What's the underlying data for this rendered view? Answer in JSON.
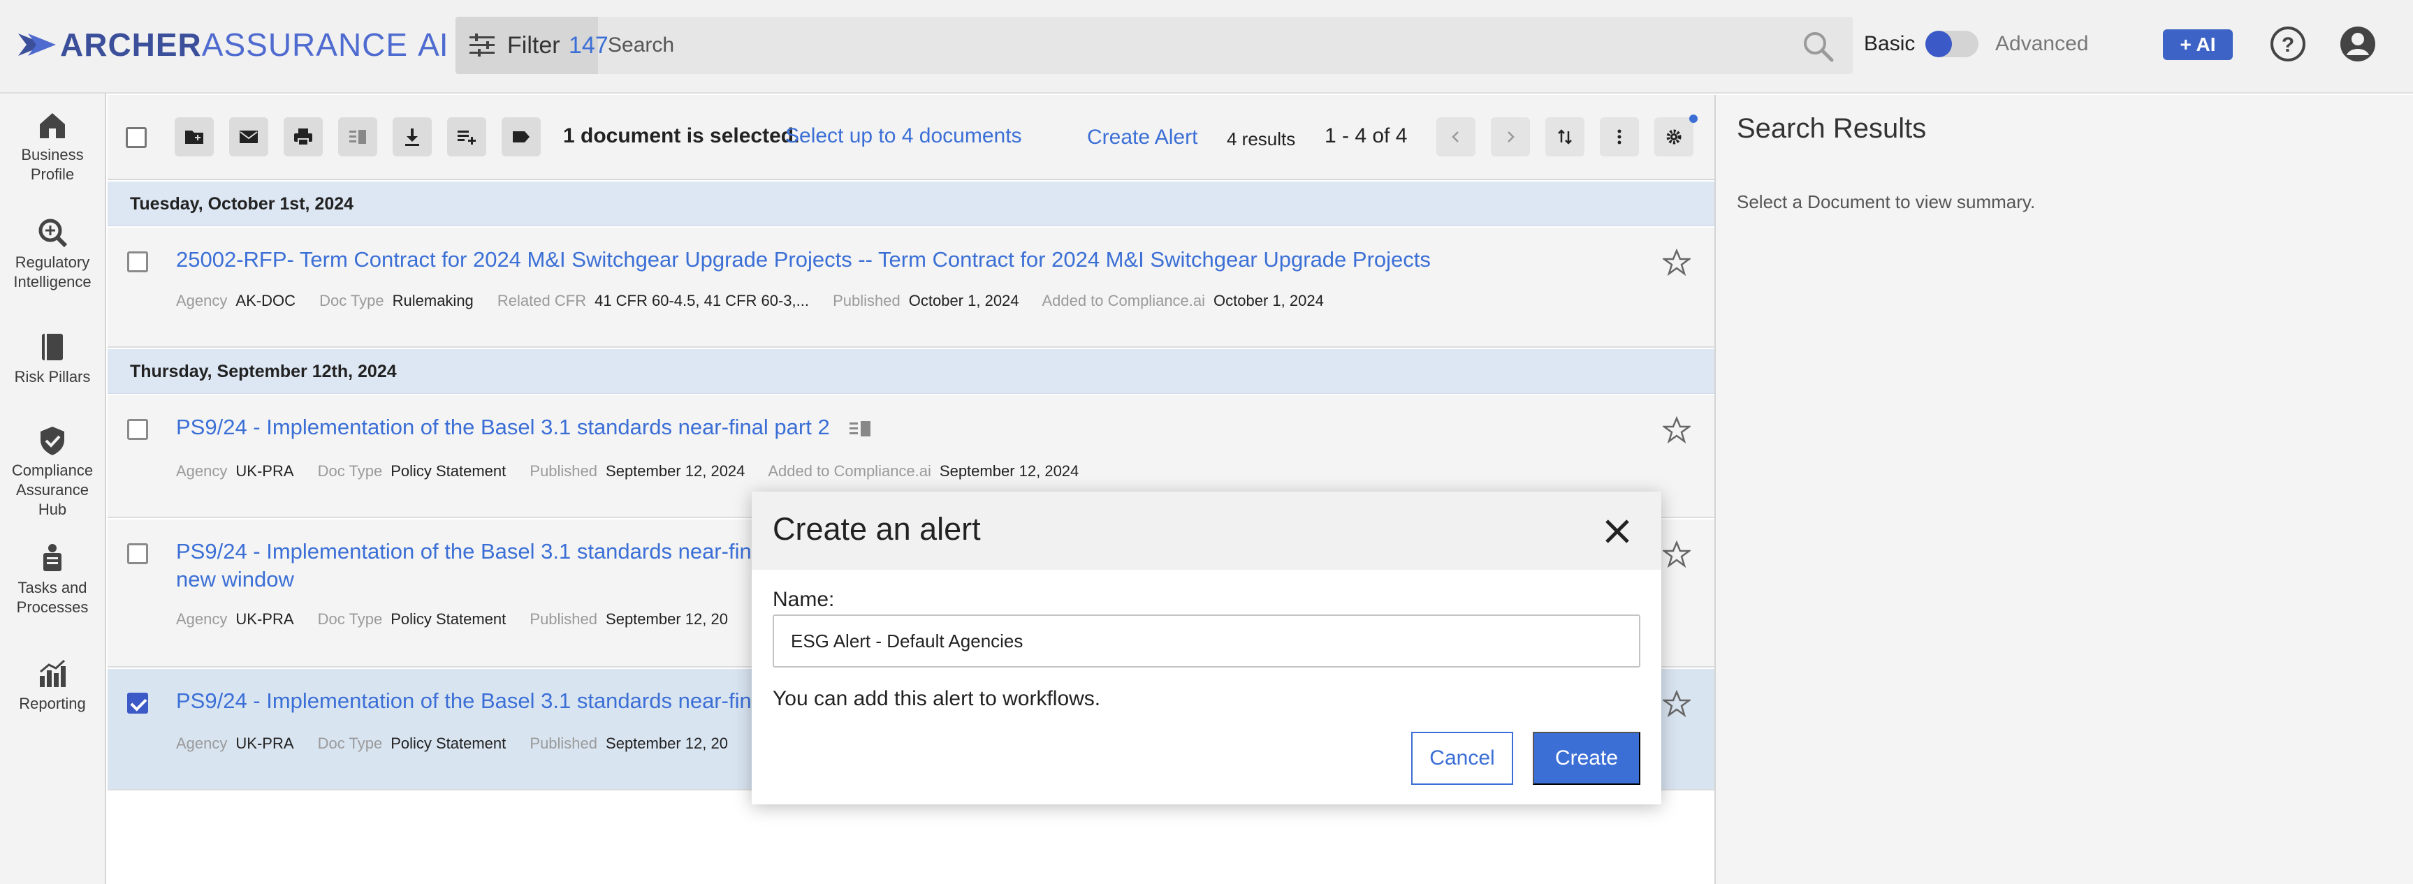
{
  "brand": {
    "word1": "ARCHER",
    "word2": "ASSURANCE",
    "word3": "AI"
  },
  "search": {
    "filter_label": "Filter",
    "filter_count": "147",
    "placeholder": "Search"
  },
  "mode": {
    "basic": "Basic",
    "advanced": "Advanced",
    "ai_button": "+ AI"
  },
  "nav": [
    {
      "label": "Business Profile",
      "icon": "home-icon"
    },
    {
      "label": "Regulatory Intelligence",
      "icon": "magnify-icon"
    },
    {
      "label": "Risk Pillars",
      "icon": "book-icon"
    },
    {
      "label": "Compliance Assurance Hub",
      "icon": "shield-check-icon"
    },
    {
      "label": "Tasks and Processes",
      "icon": "clipboard-icon"
    },
    {
      "label": "Reporting",
      "icon": "chart-icon"
    }
  ],
  "toolbar": {
    "selection_text": "1 document is selected.",
    "selection_link": "Select up to 4 documents",
    "create_alert": "Create Alert",
    "results": "4 results",
    "page_range": "1 - 4 of 4"
  },
  "groups": [
    {
      "date": "Tuesday, October 1st, 2024",
      "docs": [
        {
          "title": "25002-RFP- Term Contract for 2024 M&I Switchgear Upgrade Projects -- Term Contract for 2024 M&I Switchgear Upgrade Projects",
          "agency": "AK-DOC",
          "doc_type": "Rulemaking",
          "related_cfr": "41 CFR 60-4.5, 41 CFR 60-3,...",
          "published": "October 1, 2024",
          "added": "October 1, 2024",
          "selected": false
        }
      ]
    },
    {
      "date": "Thursday, September 12th, 2024",
      "docs": [
        {
          "title": "PS9/24 - Implementation of the Basel 3.1 standards near-final part 2",
          "agency": "UK-PRA",
          "doc_type": "Policy Statement",
          "published": "September 12, 2024",
          "added": "September 12, 2024",
          "selected": false
        },
        {
          "title_line1": "PS9/24 - Implementation of the Basel 3.1 standards near-final p",
          "title_line2": "new window",
          "agency": "UK-PRA",
          "doc_type": "Policy Statement",
          "published": "September 12, 20",
          "selected": false
        },
        {
          "title": "PS9/24 - Implementation of the Basel 3.1 standards near-final p",
          "agency": "UK-PRA",
          "doc_type": "Policy Statement",
          "published": "September 12, 20",
          "selected": true
        }
      ]
    }
  ],
  "meta_labels": {
    "agency": "Agency",
    "doc_type": "Doc Type",
    "related_cfr": "Related CFR",
    "published": "Published",
    "added": "Added to Compliance.ai"
  },
  "right_panel": {
    "title": "Search Results",
    "subtitle": "Select a Document to view summary."
  },
  "modal": {
    "title": "Create an alert",
    "name_label": "Name:",
    "name_value": "ESG Alert - Default Agencies",
    "note": "You can add this alert to workflows.",
    "cancel": "Cancel",
    "create": "Create"
  },
  "colors": {
    "accent": "#3b6fd6",
    "brand_dark": "#3b4f9a",
    "toggle": "#3b59c7",
    "date_header": "#dde7f3"
  }
}
